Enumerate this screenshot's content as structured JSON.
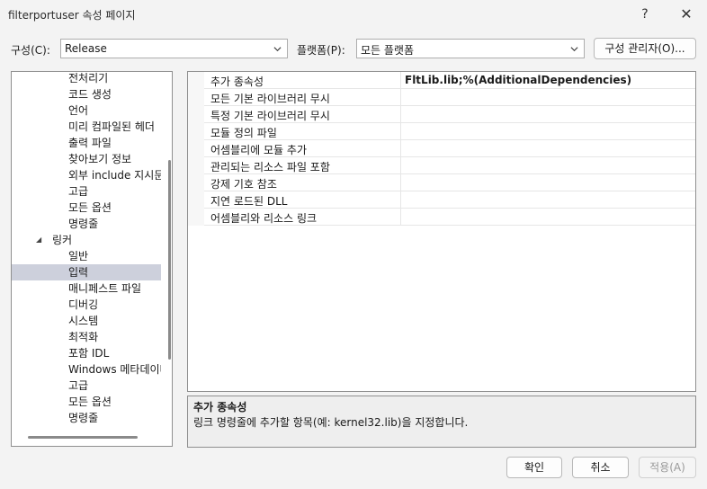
{
  "window": {
    "title": "filterportuser 속성 페이지",
    "help_glyph": "?",
    "close_glyph": "✕"
  },
  "toolbar": {
    "config_label": "구성(C):",
    "config_value": "Release",
    "platform_label": "플랫폼(P):",
    "platform_value": "모든 플랫폼",
    "config_manager_label": "구성 관리자(O)..."
  },
  "tree": {
    "items": [
      {
        "label": "전처리기",
        "level": 2,
        "selected": false
      },
      {
        "label": "코드 생성",
        "level": 2,
        "selected": false
      },
      {
        "label": "언어",
        "level": 2,
        "selected": false
      },
      {
        "label": "미리 컴파일된 헤더",
        "level": 2,
        "selected": false
      },
      {
        "label": "출력 파일",
        "level": 2,
        "selected": false
      },
      {
        "label": "찾아보기 정보",
        "level": 2,
        "selected": false
      },
      {
        "label": "외부 include 지시문",
        "level": 2,
        "selected": false
      },
      {
        "label": "고급",
        "level": 2,
        "selected": false
      },
      {
        "label": "모든 옵션",
        "level": 2,
        "selected": false
      },
      {
        "label": "명령줄",
        "level": 2,
        "selected": false
      },
      {
        "label": "링커",
        "level": 1,
        "selected": false,
        "expander": "◢"
      },
      {
        "label": "일반",
        "level": 2,
        "selected": false
      },
      {
        "label": "입력",
        "level": 2,
        "selected": true
      },
      {
        "label": "매니페스트 파일",
        "level": 2,
        "selected": false
      },
      {
        "label": "디버깅",
        "level": 2,
        "selected": false
      },
      {
        "label": "시스템",
        "level": 2,
        "selected": false
      },
      {
        "label": "최적화",
        "level": 2,
        "selected": false
      },
      {
        "label": "포함 IDL",
        "level": 2,
        "selected": false
      },
      {
        "label": "Windows 메타데이터",
        "level": 2,
        "selected": false
      },
      {
        "label": "고급",
        "level": 2,
        "selected": false
      },
      {
        "label": "모든 옵션",
        "level": 2,
        "selected": false
      },
      {
        "label": "명령줄",
        "level": 2,
        "selected": false
      }
    ]
  },
  "grid": {
    "rows": [
      {
        "name": "추가 종속성",
        "value": "FltLib.lib;%(AdditionalDependencies)"
      },
      {
        "name": "모든 기본 라이브러리 무시",
        "value": ""
      },
      {
        "name": "특정 기본 라이브러리 무시",
        "value": ""
      },
      {
        "name": "모듈 정의 파일",
        "value": ""
      },
      {
        "name": "어셈블리에 모듈 추가",
        "value": ""
      },
      {
        "name": "관리되는 리소스 파일 포함",
        "value": ""
      },
      {
        "name": "강제 기호 참조",
        "value": ""
      },
      {
        "name": "지연 로드된 DLL",
        "value": ""
      },
      {
        "name": "어셈블리와 리소스 링크",
        "value": ""
      }
    ]
  },
  "description": {
    "title": "추가 종속성",
    "text": "링크 명령줄에 추가할 항목(예: kernel32.lib)을 지정합니다."
  },
  "footer": {
    "ok_label": "확인",
    "cancel_label": "취소",
    "apply_label": "적용(A)"
  }
}
